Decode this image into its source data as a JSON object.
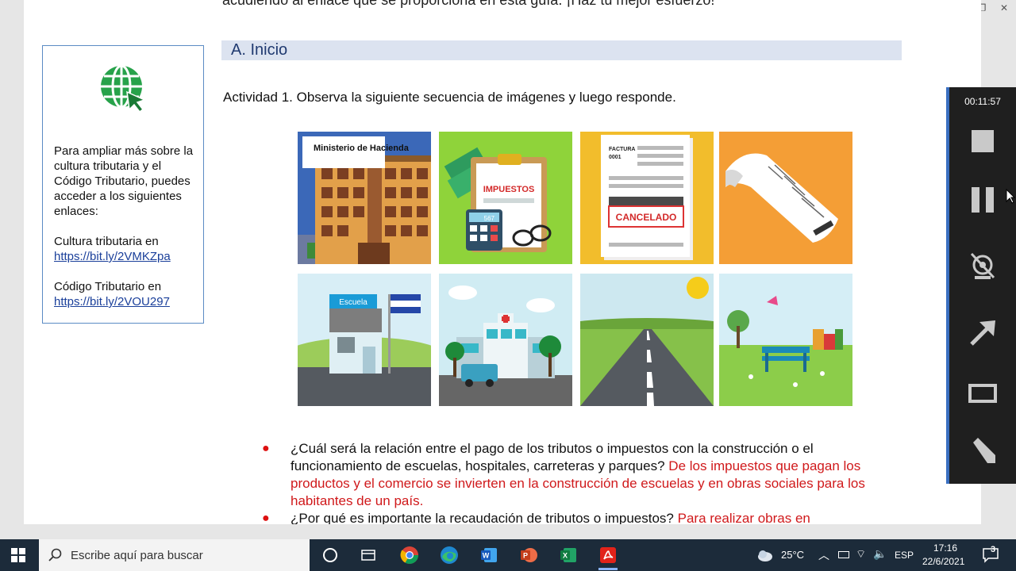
{
  "document": {
    "cut_line": "acudiendo al enlace que se proporciona en esta guía. ¡Haz tu mejor esfuerzo!",
    "side_box": {
      "intro": "Para ampliar más sobre la cultura tributaria y el Código Tributario, puedes acceder a los siguientes enlaces:",
      "link1_label": "Cultura tributaria en",
      "link1_url": "https://bit.ly/2VMKZpa",
      "link2_label": "Código Tributario en",
      "link2_url": "https://bit.ly/2VOU297"
    },
    "section_title": "A. Inicio",
    "activity": "Actividad 1. Observa la siguiente secuencia de imágenes y luego responde.",
    "images": {
      "ministerio": "Ministerio de Hacienda",
      "impuestos": "IMPUESTOS",
      "calc_display": "567",
      "factura": "FACTURA",
      "factura_num": "0001",
      "cancelado": "CANCELADO",
      "escuela": "Escuela"
    },
    "questions": [
      {
        "question": "¿Cuál será la relación entre el pago de los tributos o impuestos con la construcción o el funcionamiento de escuelas, hospitales, carreteras y parques?",
        "answer": "De los impuestos que pagan los productos y el comercio se invierten en la construcción de escuelas y en obras sociales para los habitantes de un país."
      },
      {
        "question": "¿Por qué es importante la recaudación de tributos o impuestos?",
        "answer": "Para realizar obras en"
      }
    ]
  },
  "recorder": {
    "timer": "00:11:57",
    "buttons": [
      "stop-icon",
      "pause-icon",
      "webcam-off-icon",
      "arrow-icon",
      "rectangle-icon",
      "pen-icon"
    ]
  },
  "taskbar": {
    "search_placeholder": "Escribe aquí para buscar",
    "apps": [
      "task-view-icon",
      "widgets-icon",
      "chrome-icon",
      "edge-icon",
      "word-icon",
      "powerpoint-icon",
      "excel-icon",
      "acrobat-icon"
    ],
    "temperature": "25°C",
    "language": "ESP",
    "time": "17:16",
    "date": "22/6/2021",
    "notifications": "3"
  },
  "colors": {
    "accent": "#3a6fc0",
    "answer_red": "#d0191b",
    "section_band": "#dce3f0",
    "taskbar": "#1c2b3a"
  }
}
